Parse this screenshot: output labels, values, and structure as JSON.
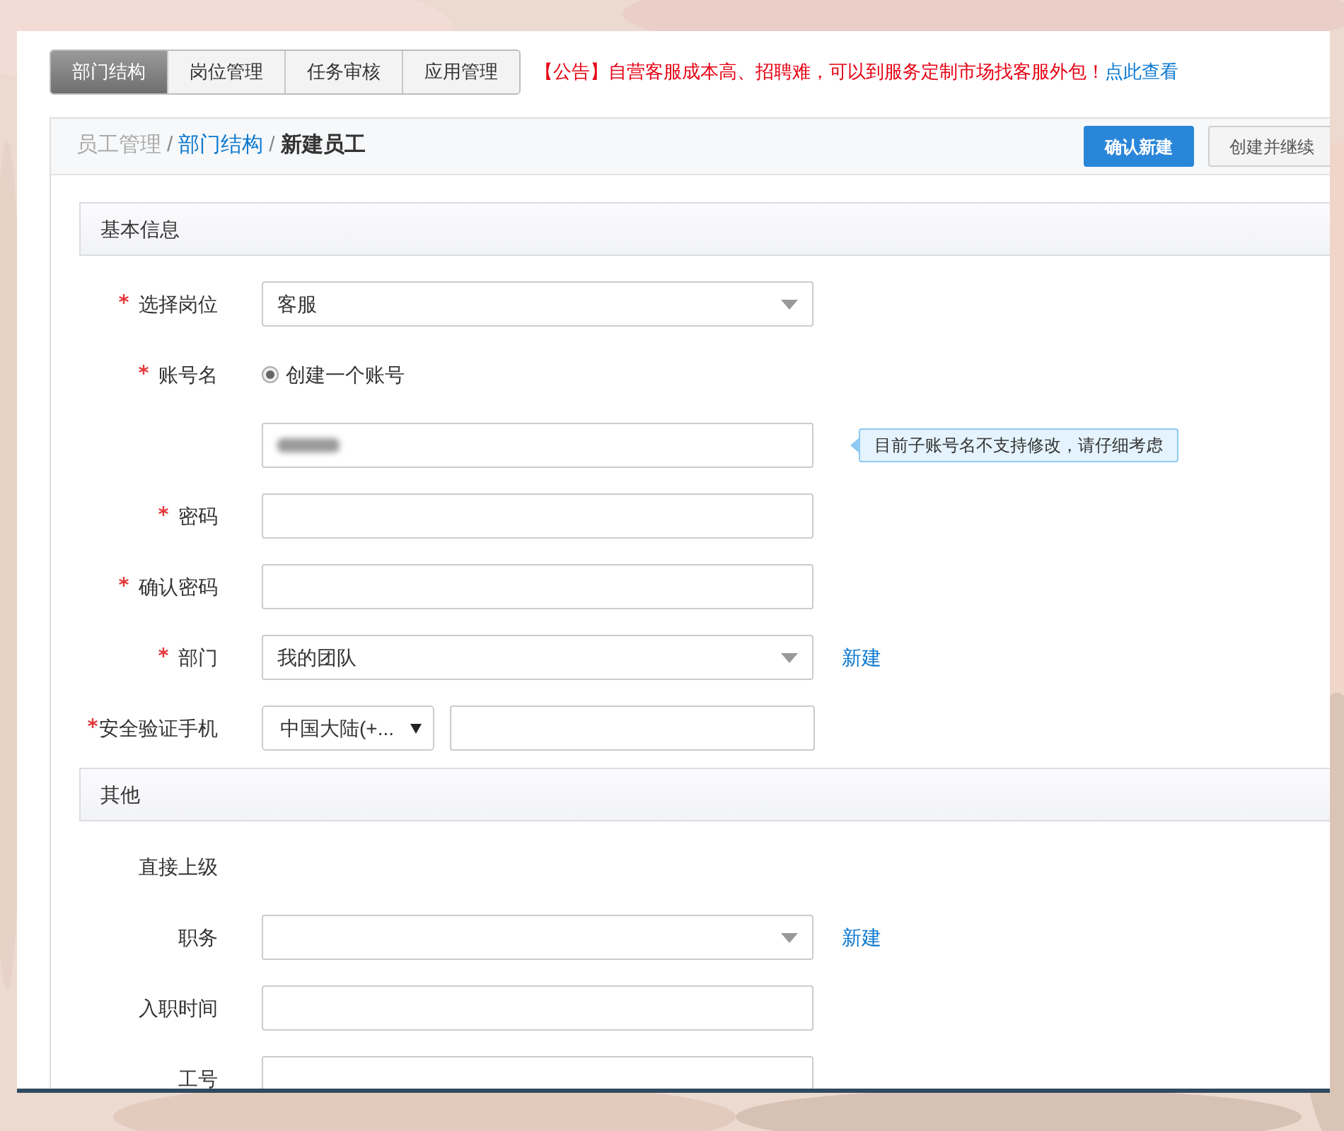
{
  "tabs": [
    {
      "label": "部门结构",
      "selected": true
    },
    {
      "label": "岗位管理",
      "selected": false
    },
    {
      "label": "任务审核",
      "selected": false
    },
    {
      "label": "应用管理",
      "selected": false
    }
  ],
  "notice": {
    "tag": "【公告】",
    "text": "自营客服成本高、招聘难，可以到服务定制市场找客服外包！",
    "link": "点此查看"
  },
  "breadcrumb": [
    {
      "label": "员工管理",
      "kind": "muted"
    },
    {
      "label": "/",
      "kind": "separator"
    },
    {
      "label": "部门结构",
      "kind": "link"
    },
    {
      "label": "/",
      "kind": "separator"
    },
    {
      "label": "新建员工",
      "kind": "current"
    }
  ],
  "buttons": [
    {
      "label": "确认新建",
      "kind": "primary"
    },
    {
      "label": "创建并继续",
      "kind": "default"
    }
  ],
  "sections": [
    {
      "title": "基本信息",
      "rows": [
        {
          "kind": "select",
          "label": "选择岗位",
          "required": true,
          "value": "客服"
        },
        {
          "kind": "radio",
          "label": "账号名",
          "required": true,
          "option": "创建一个账号",
          "checked": true
        },
        {
          "kind": "input",
          "redacted": true,
          "hint": "目前子账号名不支持修改，请仔细考虑"
        },
        {
          "kind": "input",
          "label": "密码",
          "required": true
        },
        {
          "kind": "input",
          "label": "确认密码",
          "required": true
        },
        {
          "kind": "select",
          "label": "部门",
          "required": true,
          "value": "我的团队",
          "link": "新建"
        },
        {
          "kind": "phone",
          "label": "安全验证手机",
          "required": true,
          "country": "中国大陆(+..."
        }
      ]
    },
    {
      "title": "其他",
      "rows": [
        {
          "kind": "text",
          "label": "直接上级",
          "required": false
        },
        {
          "kind": "select",
          "label": "职务",
          "required": false,
          "link": "新建"
        },
        {
          "kind": "input",
          "label": "入职时间",
          "required": false
        },
        {
          "kind": "input",
          "label": "工号",
          "required": false
        }
      ]
    }
  ]
}
